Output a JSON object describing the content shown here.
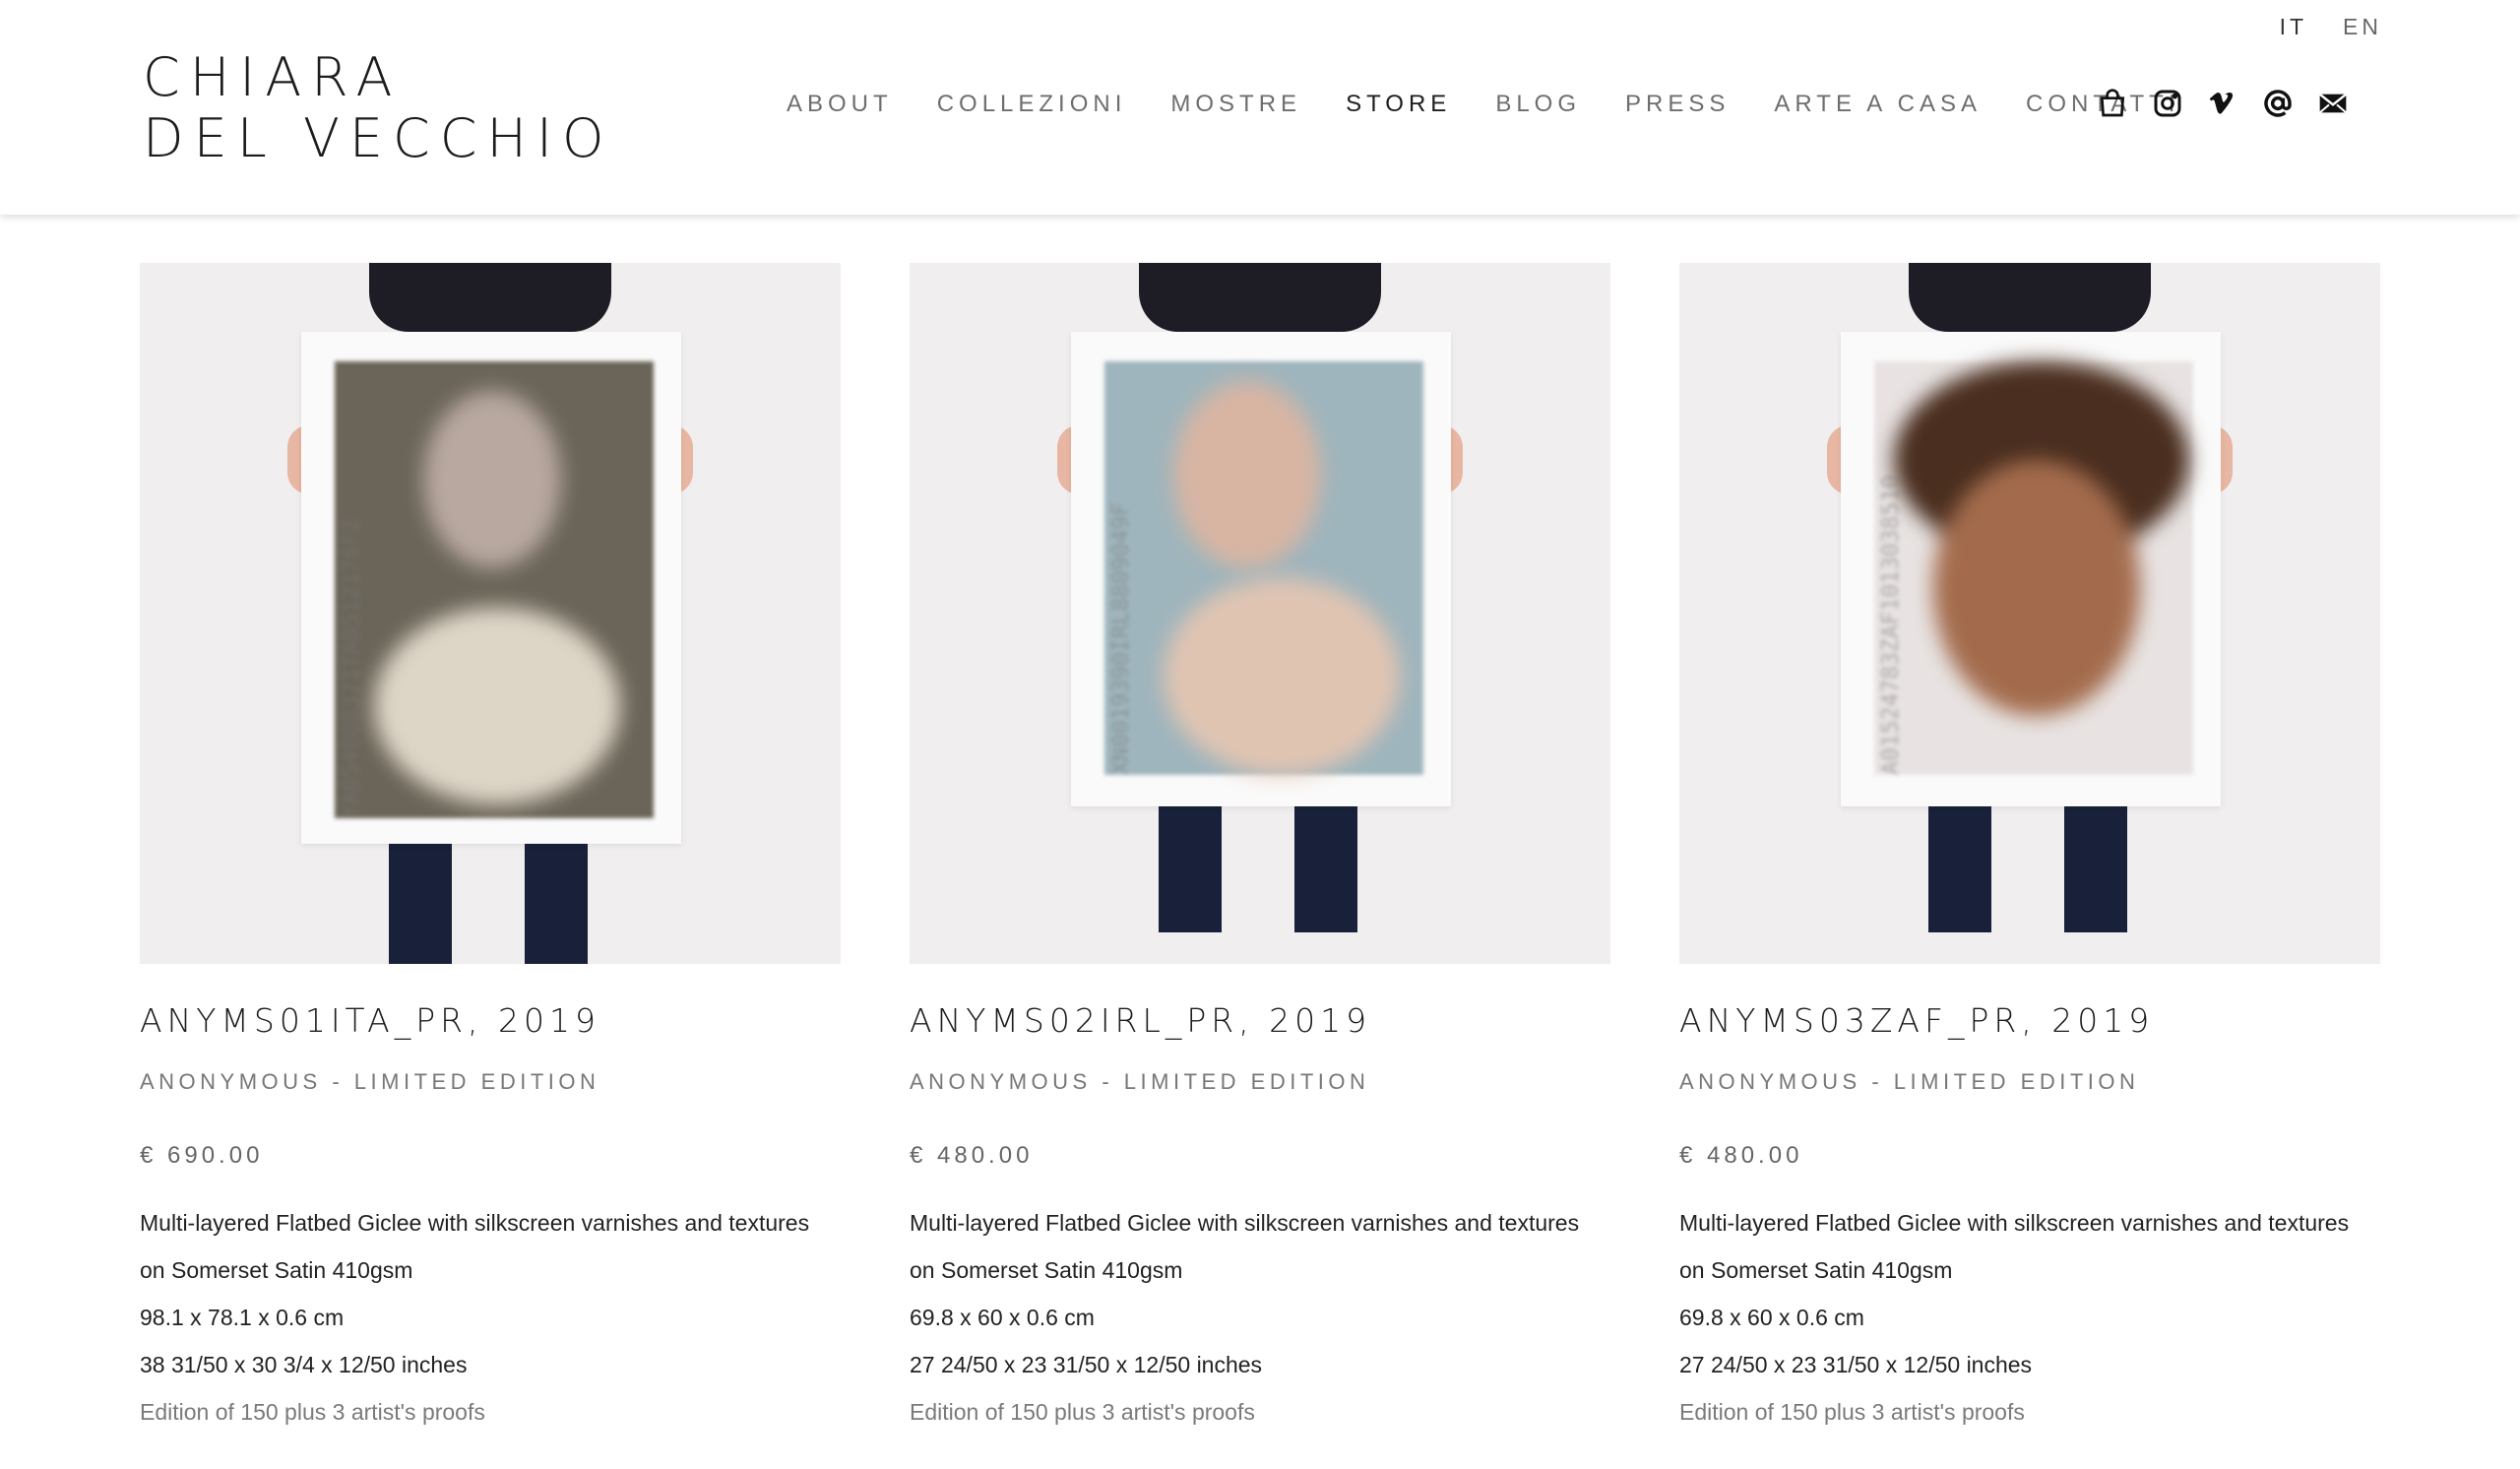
{
  "logo": {
    "line1": "CHIARA",
    "line2": "DEL VECCHIO"
  },
  "languages": [
    {
      "label": "IT",
      "active": true
    },
    {
      "label": "EN",
      "active": false
    }
  ],
  "nav": [
    {
      "label": "ABOUT"
    },
    {
      "label": "COLLEZIONI"
    },
    {
      "label": "MOSTRE"
    },
    {
      "label": "STORE",
      "current": true
    },
    {
      "label": "BLOG"
    },
    {
      "label": "PRESS"
    },
    {
      "label": "ARTE A CASA"
    },
    {
      "label": "CONTATTI"
    }
  ],
  "social_icons": [
    "shopping-bag-icon",
    "instagram-icon",
    "vimeo-icon",
    "threads-icon",
    "email-icon"
  ],
  "products": [
    {
      "title": "ANYMS01ITA_PR, 2019",
      "subtitle": "ANONYMOUS - LIMITED EDITION",
      "price": "€ 690.00",
      "desc1": "Multi-layered Flatbed Giclee with silkscreen varnishes and textures",
      "desc2": "on Somerset Satin 410gsm",
      "dims_cm": "98.1 x 78.1 x 0.6 cm",
      "dims_in": "38 31/50 x 30 3/4 x 12/50 inches",
      "edition": "Edition of 150 plus 3 artist's proofs",
      "print_code": "YA05400837ITA8512176F2",
      "print_bg": "#6b6559",
      "print_face": "#b8a8a0"
    },
    {
      "title": "ANYMS02IRL_PR, 2019",
      "subtitle": "ANONYMOUS - LIMITED EDITION",
      "price": "€ 480.00",
      "desc1": "Multi-layered Flatbed Giclee with silkscreen varnishes and textures",
      "desc2": "on Somerset Satin 410gsm",
      "dims_cm": "69.8 x 60 x 0.6 cm",
      "dims_in": "27 24/50 x 23 31/50 x 12/50 inches",
      "edition": "Edition of 150 plus 3 artist's proofs",
      "print_code": "XN0019390IRL8809049F",
      "print_bg": "#9fb5bd",
      "print_face": "#d8b5a3"
    },
    {
      "title": "ANYMS03ZAF_PR, 2019",
      "subtitle": "ANONYMOUS - LIMITED EDITION",
      "price": "€ 480.00",
      "desc1": "Multi-layered Flatbed Giclee with silkscreen varnishes and textures",
      "desc2": "on Somerset Satin 410gsm",
      "dims_cm": "69.8 x 60 x 0.6 cm",
      "dims_in": "27 24/50 x 23 31/50 x 12/50 inches",
      "edition": "Edition of 150 plus 3 artist's proofs",
      "print_code": "A01524783ZAF1013038510",
      "print_bg": "#e8e3e2",
      "print_face": "#a36b4c"
    }
  ]
}
